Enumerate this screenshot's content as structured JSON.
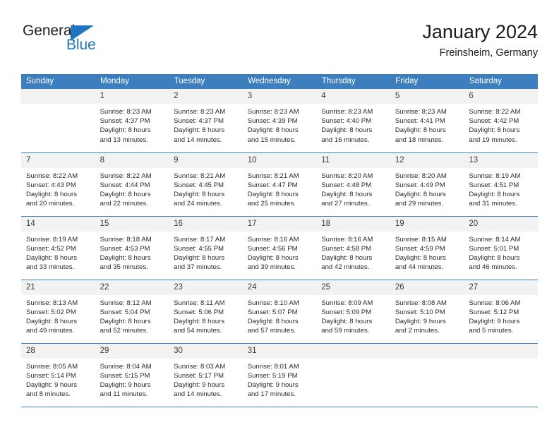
{
  "brand": {
    "name_part1": "General",
    "name_part2": "Blue",
    "flag_icon": "triangle-flag-icon",
    "color_primary": "#1f76bc",
    "color_text": "#231f20"
  },
  "header": {
    "title": "January 2024",
    "subtitle": "Freinsheim, Germany"
  },
  "theme": {
    "header_bg": "#3d7ebe",
    "daynum_bg": "#f2f2f2",
    "row_border": "#3d7ebe"
  },
  "weekdays": [
    "Sunday",
    "Monday",
    "Tuesday",
    "Wednesday",
    "Thursday",
    "Friday",
    "Saturday"
  ],
  "weeks": [
    [
      {
        "day": "",
        "lines": []
      },
      {
        "day": "1",
        "lines": [
          "Sunrise: 8:23 AM",
          "Sunset: 4:37 PM",
          "Daylight: 8 hours",
          "and 13 minutes."
        ]
      },
      {
        "day": "2",
        "lines": [
          "Sunrise: 8:23 AM",
          "Sunset: 4:37 PM",
          "Daylight: 8 hours",
          "and 14 minutes."
        ]
      },
      {
        "day": "3",
        "lines": [
          "Sunrise: 8:23 AM",
          "Sunset: 4:39 PM",
          "Daylight: 8 hours",
          "and 15 minutes."
        ]
      },
      {
        "day": "4",
        "lines": [
          "Sunrise: 8:23 AM",
          "Sunset: 4:40 PM",
          "Daylight: 8 hours",
          "and 16 minutes."
        ]
      },
      {
        "day": "5",
        "lines": [
          "Sunrise: 8:23 AM",
          "Sunset: 4:41 PM",
          "Daylight: 8 hours",
          "and 18 minutes."
        ]
      },
      {
        "day": "6",
        "lines": [
          "Sunrise: 8:22 AM",
          "Sunset: 4:42 PM",
          "Daylight: 8 hours",
          "and 19 minutes."
        ]
      }
    ],
    [
      {
        "day": "7",
        "lines": [
          "Sunrise: 8:22 AM",
          "Sunset: 4:43 PM",
          "Daylight: 8 hours",
          "and 20 minutes."
        ]
      },
      {
        "day": "8",
        "lines": [
          "Sunrise: 8:22 AM",
          "Sunset: 4:44 PM",
          "Daylight: 8 hours",
          "and 22 minutes."
        ]
      },
      {
        "day": "9",
        "lines": [
          "Sunrise: 8:21 AM",
          "Sunset: 4:45 PM",
          "Daylight: 8 hours",
          "and 24 minutes."
        ]
      },
      {
        "day": "10",
        "lines": [
          "Sunrise: 8:21 AM",
          "Sunset: 4:47 PM",
          "Daylight: 8 hours",
          "and 25 minutes."
        ]
      },
      {
        "day": "11",
        "lines": [
          "Sunrise: 8:20 AM",
          "Sunset: 4:48 PM",
          "Daylight: 8 hours",
          "and 27 minutes."
        ]
      },
      {
        "day": "12",
        "lines": [
          "Sunrise: 8:20 AM",
          "Sunset: 4:49 PM",
          "Daylight: 8 hours",
          "and 29 minutes."
        ]
      },
      {
        "day": "13",
        "lines": [
          "Sunrise: 8:19 AM",
          "Sunset: 4:51 PM",
          "Daylight: 8 hours",
          "and 31 minutes."
        ]
      }
    ],
    [
      {
        "day": "14",
        "lines": [
          "Sunrise: 8:19 AM",
          "Sunset: 4:52 PM",
          "Daylight: 8 hours",
          "and 33 minutes."
        ]
      },
      {
        "day": "15",
        "lines": [
          "Sunrise: 8:18 AM",
          "Sunset: 4:53 PM",
          "Daylight: 8 hours",
          "and 35 minutes."
        ]
      },
      {
        "day": "16",
        "lines": [
          "Sunrise: 8:17 AM",
          "Sunset: 4:55 PM",
          "Daylight: 8 hours",
          "and 37 minutes."
        ]
      },
      {
        "day": "17",
        "lines": [
          "Sunrise: 8:16 AM",
          "Sunset: 4:56 PM",
          "Daylight: 8 hours",
          "and 39 minutes."
        ]
      },
      {
        "day": "18",
        "lines": [
          "Sunrise: 8:16 AM",
          "Sunset: 4:58 PM",
          "Daylight: 8 hours",
          "and 42 minutes."
        ]
      },
      {
        "day": "19",
        "lines": [
          "Sunrise: 8:15 AM",
          "Sunset: 4:59 PM",
          "Daylight: 8 hours",
          "and 44 minutes."
        ]
      },
      {
        "day": "20",
        "lines": [
          "Sunrise: 8:14 AM",
          "Sunset: 5:01 PM",
          "Daylight: 8 hours",
          "and 46 minutes."
        ]
      }
    ],
    [
      {
        "day": "21",
        "lines": [
          "Sunrise: 8:13 AM",
          "Sunset: 5:02 PM",
          "Daylight: 8 hours",
          "and 49 minutes."
        ]
      },
      {
        "day": "22",
        "lines": [
          "Sunrise: 8:12 AM",
          "Sunset: 5:04 PM",
          "Daylight: 8 hours",
          "and 52 minutes."
        ]
      },
      {
        "day": "23",
        "lines": [
          "Sunrise: 8:11 AM",
          "Sunset: 5:06 PM",
          "Daylight: 8 hours",
          "and 54 minutes."
        ]
      },
      {
        "day": "24",
        "lines": [
          "Sunrise: 8:10 AM",
          "Sunset: 5:07 PM",
          "Daylight: 8 hours",
          "and 57 minutes."
        ]
      },
      {
        "day": "25",
        "lines": [
          "Sunrise: 8:09 AM",
          "Sunset: 5:09 PM",
          "Daylight: 8 hours",
          "and 59 minutes."
        ]
      },
      {
        "day": "26",
        "lines": [
          "Sunrise: 8:08 AM",
          "Sunset: 5:10 PM",
          "Daylight: 9 hours",
          "and 2 minutes."
        ]
      },
      {
        "day": "27",
        "lines": [
          "Sunrise: 8:06 AM",
          "Sunset: 5:12 PM",
          "Daylight: 9 hours",
          "and 5 minutes."
        ]
      }
    ],
    [
      {
        "day": "28",
        "lines": [
          "Sunrise: 8:05 AM",
          "Sunset: 5:14 PM",
          "Daylight: 9 hours",
          "and 8 minutes."
        ]
      },
      {
        "day": "29",
        "lines": [
          "Sunrise: 8:04 AM",
          "Sunset: 5:15 PM",
          "Daylight: 9 hours",
          "and 11 minutes."
        ]
      },
      {
        "day": "30",
        "lines": [
          "Sunrise: 8:03 AM",
          "Sunset: 5:17 PM",
          "Daylight: 9 hours",
          "and 14 minutes."
        ]
      },
      {
        "day": "31",
        "lines": [
          "Sunrise: 8:01 AM",
          "Sunset: 5:19 PM",
          "Daylight: 9 hours",
          "and 17 minutes."
        ]
      },
      {
        "day": "",
        "lines": []
      },
      {
        "day": "",
        "lines": []
      },
      {
        "day": "",
        "lines": []
      }
    ]
  ]
}
